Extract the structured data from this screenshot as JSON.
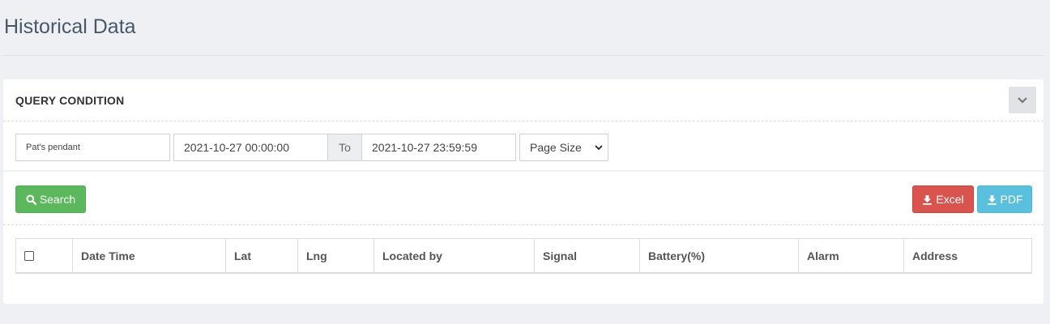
{
  "page": {
    "title": "Historical Data"
  },
  "query": {
    "title": "QUERY CONDITION",
    "device": "Pat's pendant",
    "start_time": "2021-10-27 00:00:00",
    "to_label": "To",
    "end_time": "2021-10-27 23:59:59",
    "page_size": "Page Size"
  },
  "actions": {
    "search": "Search",
    "excel": "Excel",
    "pdf": "PDF"
  },
  "table": {
    "columns": [
      "Date Time",
      "Lat",
      "Lng",
      "Located by",
      "Signal",
      "Battery(%)",
      "Alarm",
      "Address"
    ]
  },
  "icons": [
    "chevron-down-icon",
    "search-icon",
    "download-icon",
    "checkbox-icon"
  ],
  "colors": {
    "search": "#5cb85c",
    "excel": "#d9534f",
    "pdf": "#5bc0de"
  }
}
